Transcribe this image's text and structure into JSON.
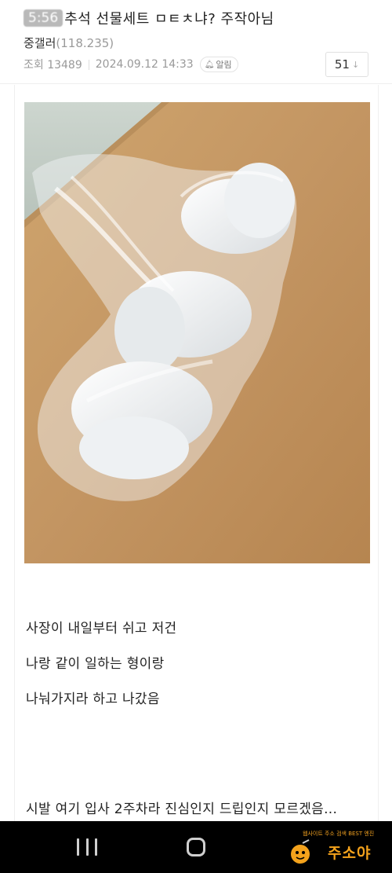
{
  "header": {
    "status_time": "5:56",
    "title": "추석 선물세트 ㅁㅌㅊ냐? 주작아님",
    "author": "중갤러",
    "author_id": "(118.235)",
    "views": "조회 13489",
    "datetime": "2024.09.12 14:33",
    "alarm_label": "알림",
    "comment_count": "51"
  },
  "post": {
    "paragraphs": [
      "사장이 내일부터 쉬고 저건",
      "나랑 같이 일하는 형이랑",
      "나눠가지라 하고 나갔음",
      "시발 여기 입사 2주차라 진심인지 드립인지 모르겠음..."
    ]
  },
  "watermark": {
    "tagline": "웹사이트 주소 검색 BEST 엔진",
    "brand": "주소야"
  },
  "colors": {
    "desk": "#c29460",
    "watermark": "#f3a21c",
    "navbar": "#000000"
  }
}
